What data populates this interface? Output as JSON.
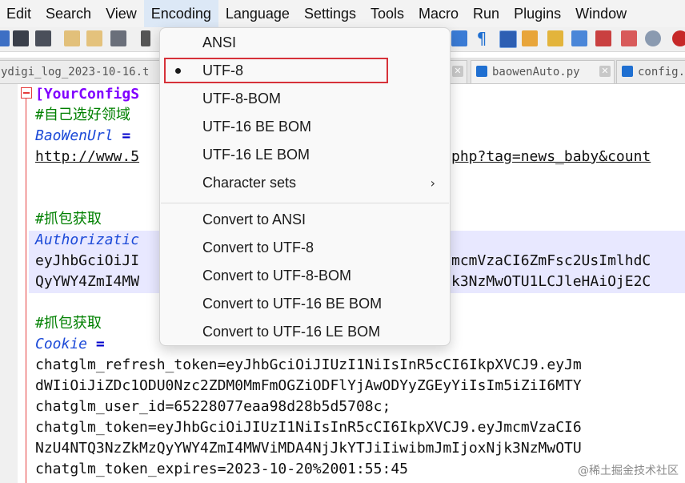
{
  "menubar": {
    "items": [
      "Edit",
      "Search",
      "View",
      "Encoding",
      "Language",
      "Settings",
      "Tools",
      "Macro",
      "Run",
      "Plugins",
      "Window"
    ],
    "active": "Encoding"
  },
  "tabs": [
    {
      "label": "ydigi_log_2023-10-16.t"
    },
    {
      "label": "baowenAuto.py"
    },
    {
      "label": "config."
    }
  ],
  "editor": {
    "section_header": "[YourConfigS",
    "comment_1": "#自己选好领域",
    "baowen_key": "BaoWenUrl",
    "eq": "=",
    "url_left": "http://www.5",
    "url_right": "php?tag=news_baby&count",
    "comment_2": "#抓包获取",
    "auth_key": "Authorizatic",
    "auth_line1_left": "eyJhbGciOiJI",
    "auth_line1_right": "mcmVzaCI6ZmFsc2UsImlhdC",
    "auth_line2_left": "QyYWY4ZmI4MW",
    "auth_line2_right": "k3NzMwOTU1LCJleHAiOjE2C",
    "comment_3": "#抓包获取",
    "cookie_key": "Cookie",
    "cookie_1": "chatglm_refresh_token=eyJhbGciOiJIUzI1NiIsInR5cCI6IkpXVCJ9.eyJm",
    "cookie_2": "dWIiOiJiZDc1ODU0Nzc2ZDM0MmFmOGZiODFlYjAwODYyZGEyYiIsIm5iZiI6MTY",
    "cookie_3": "chatglm_user_id=65228077eaa98d28b5d5708c;",
    "cookie_4": "chatglm_token=eyJhbGciOiJIUzI1NiIsInR5cCI6IkpXVCJ9.eyJmcmVzaCI6",
    "cookie_5": "NzU4NTQ3NzZkMzQyYWY4ZmI4MWViMDA4NjJkYTJiIiwibmJmIjoxNjk3NzMwOTU",
    "cookie_6": "chatglm_token_expires=2023-10-20%2001:55:45"
  },
  "encoding_menu": {
    "items": [
      {
        "label": "ANSI"
      },
      {
        "label": "UTF-8",
        "checked": true
      },
      {
        "label": "UTF-8-BOM"
      },
      {
        "label": "UTF-16 BE BOM"
      },
      {
        "label": "UTF-16 LE BOM"
      },
      {
        "label": "Character sets",
        "submenu": true,
        "arrow": "›"
      },
      {
        "label": "Convert to ANSI"
      },
      {
        "label": "Convert to UTF-8"
      },
      {
        "label": "Convert to UTF-8-BOM"
      },
      {
        "label": "Convert to UTF-16 BE BOM"
      },
      {
        "label": "Convert to UTF-16 LE BOM"
      }
    ]
  },
  "watermark": "@稀土掘金技术社区",
  "colors": {
    "highlight_box": "#d6323a",
    "fold_marker": "#e53b3b",
    "section": "#8000ff",
    "comment": "#008000",
    "key": "#1c4ad8"
  }
}
